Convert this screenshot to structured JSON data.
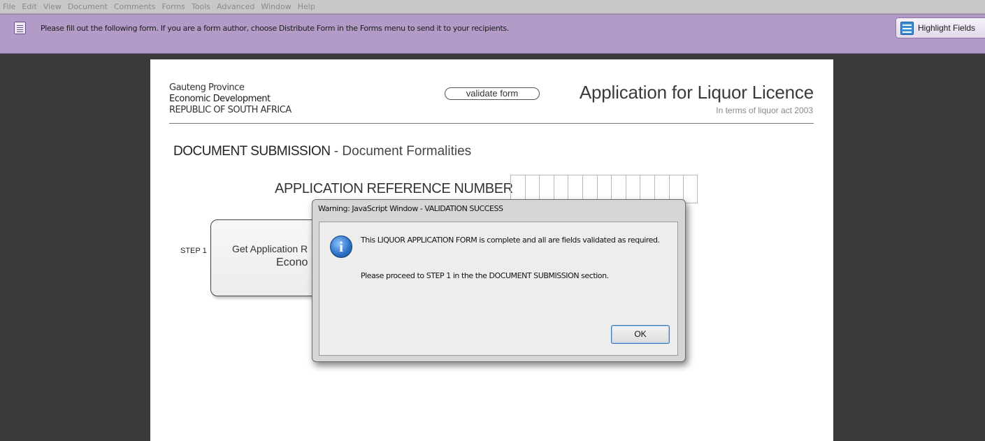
{
  "menu": [
    "File",
    "Edit",
    "View",
    "Document",
    "Comments",
    "Forms",
    "Tools",
    "Advanced",
    "Window",
    "Help"
  ],
  "message_bar": {
    "text": "Please fill out the following form. If you are a form author, choose Distribute Form in the Forms menu to send it to your recipients.",
    "icon": "document-icon",
    "highlight_label": "Highlight Fields"
  },
  "form": {
    "province": "Gauteng Province",
    "department": "Economic Development",
    "country": "REPUBLIC OF SOUTH AFRICA",
    "validate_label": "validate form",
    "title": "Application for Liquor Licence",
    "subtitle": "In terms of liquor act 2003",
    "section_title": "DOCUMENT SUBMISSION",
    "section_subtitle": "- Document Formalities",
    "reference_label": "APPLICATION REFERENCE NUMBER",
    "reference_cells": 13,
    "step_label": "STEP 1",
    "step_text_1": "Get Application R",
    "step_text_2": "Econo"
  },
  "dialog": {
    "title": "Warning: JavaScript Window - VALIDATION SUCCESS",
    "icon": "info-icon",
    "message_line_1": "This LIQUOR APPLICATION FORM is complete and all are fields validated as required.",
    "message_line_2": "Please proceed to STEP 1 in the the DOCUMENT SUBMISSION section.",
    "ok_label": "OK"
  }
}
